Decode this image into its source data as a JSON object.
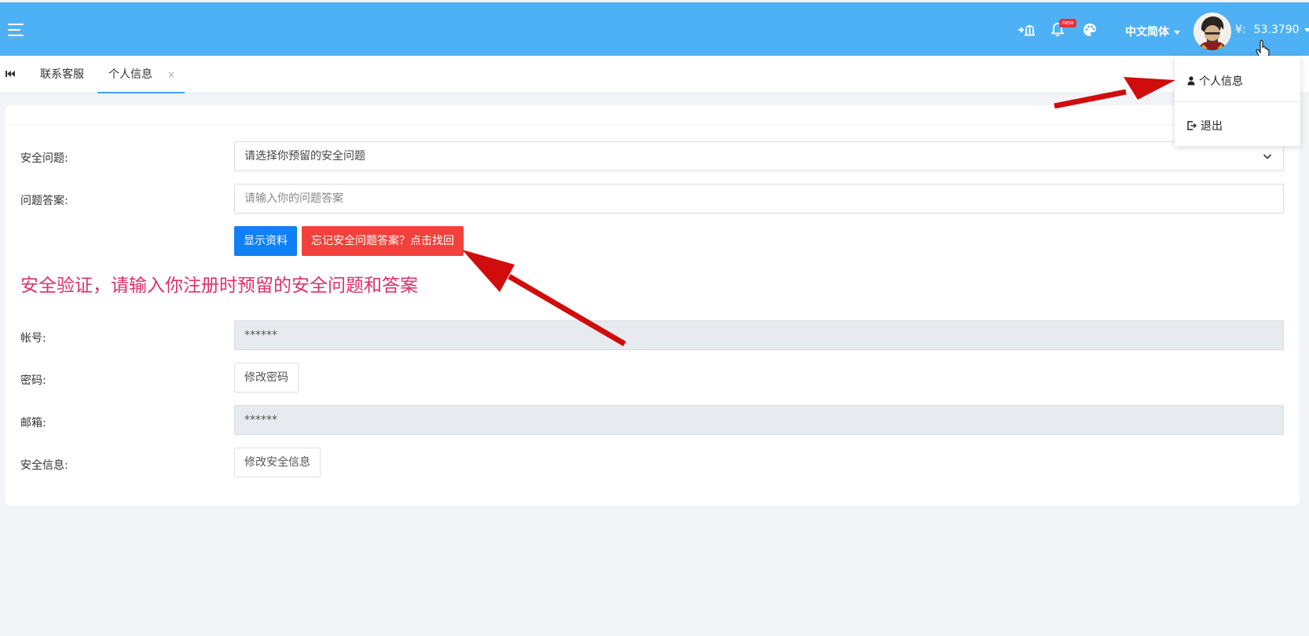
{
  "header": {
    "language": "中文简体",
    "currency_symbol": "¥:",
    "balance": "53.3790",
    "badge": "new",
    "colors": {
      "bar": "#4eb1f5",
      "badge": "#ef3030"
    }
  },
  "tabs": {
    "items": [
      {
        "label": "联系客服"
      },
      {
        "label": "个人信息"
      }
    ],
    "close": "×"
  },
  "form": {
    "security_question": {
      "label": "安全问题:",
      "value": "请选择你预留的安全问题"
    },
    "answer": {
      "label": "问题答案:",
      "placeholder": "请输入你的问题答案"
    },
    "show_button": "显示资料",
    "forgot_button": "忘记安全问题答案？点击找回",
    "notice": "安全验证，请输入你注册时预留的安全问题和答案",
    "account": {
      "label": "帐号:",
      "value": "******"
    },
    "password": {
      "label": "密码:",
      "button": "修改密码"
    },
    "email": {
      "label": "邮箱:",
      "value": "******"
    },
    "security_info": {
      "label": "安全信息:",
      "button": "修改安全信息"
    }
  },
  "dropdown": {
    "items": [
      {
        "label": "个人信息",
        "icon": "user-icon"
      },
      {
        "label": "退出",
        "icon": "logout-icon"
      }
    ]
  },
  "colors": {
    "primary_button": "#1080f5",
    "danger_button": "#f2413c",
    "notice_text": "#df2f6b",
    "annotation_arrow": "#d00c0c"
  }
}
